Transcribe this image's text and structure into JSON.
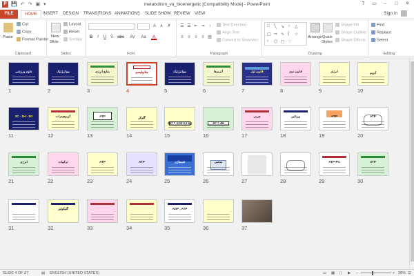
{
  "window": {
    "title": "metabolism_va_bioenergetic [Compatibility Mode] - PowerPoint"
  },
  "qat": {
    "save": "💾",
    "undo": "↶",
    "redo": "↷",
    "start": "▣",
    "more": "▾"
  },
  "window_controls": {
    "help": "?",
    "ribbon_opts": "▭",
    "minimize": "–",
    "maximize": "□",
    "close": "✕"
  },
  "tabs": {
    "file": "FILE",
    "home": "HOME",
    "insert": "INSERT",
    "design": "DESIGN",
    "transitions": "TRANSITIONS",
    "animations": "ANIMATIONS",
    "slideshow": "SLIDE SHOW",
    "review": "REVIEW",
    "view": "VIEW"
  },
  "signin": "Sign in",
  "ribbon": {
    "clipboard": {
      "paste": "Paste",
      "cut": "Cut",
      "copy": "Copy",
      "format_painter": "Format Painter",
      "label": "Clipboard"
    },
    "slides": {
      "new_slide": "New",
      "new_slide2": "Slide",
      "layout": "Layout",
      "reset": "Reset",
      "section": "Section",
      "label": "Slides"
    },
    "font": {
      "bold": "B",
      "italic": "I",
      "underline": "U",
      "strike": "S",
      "shadow": "abc",
      "spacing": "AV",
      "case": "Aa",
      "color": "A",
      "grow": "A",
      "shrink": "A",
      "clear": "✗",
      "label": "Font"
    },
    "paragraph": {
      "text_direction": "Text Direction",
      "align_text": "Align Text",
      "convert_smartart": "Convert to SmartArt",
      "label": "Paragraph"
    },
    "drawing": {
      "arrange": "Arrange",
      "quick_styles": "Quick",
      "quick_styles2": "Styles",
      "shape_fill": "Shape Fill",
      "shape_outline": "Shape Outline",
      "shape_effects": "Shape Effects",
      "label": "Drawing"
    },
    "editing": {
      "find": "Find",
      "replace": "Replace",
      "select": "Select",
      "label": "Editing"
    }
  },
  "slides": [
    {
      "n": "1",
      "bg": "#1a1f6e",
      "title": "علوم ورزشی",
      "tc": "#ffffff",
      "style": "dark"
    },
    {
      "n": "2",
      "bg": "#1a1f6e",
      "title": "بیوانرژتیک",
      "tc": "#ffffff",
      "style": "dark-lines"
    },
    {
      "n": "3",
      "bg": "#f4f6cc",
      "title": "منابع انرژی",
      "tc": "#222222",
      "style": "green-bars"
    },
    {
      "n": "4",
      "bg": "#ffffff",
      "title": "متابولیسم",
      "tc": "#c00000",
      "style": "selected"
    },
    {
      "n": "5",
      "bg": "#1a1f6e",
      "title": "بیوانرژتیک",
      "tc": "#ffffff",
      "style": "dark-lines"
    },
    {
      "n": "6",
      "bg": "#f4f6cc",
      "title": "آنزیم‌ها",
      "tc": "#222222",
      "style": "green-bars"
    },
    {
      "n": "7",
      "bg": "#2a2f8a",
      "title": "قانون اول",
      "tc": "#ffff66",
      "style": "dark-bar"
    },
    {
      "n": "8",
      "bg": "#ffd6ec",
      "title": "قانون دوم",
      "tc": "#222222",
      "style": "pink"
    },
    {
      "n": "9",
      "bg": "#ffffcc",
      "title": "انرژی",
      "tc": "#222222",
      "style": "light"
    },
    {
      "n": "10",
      "bg": "#ffffcc",
      "title": "آنزیم",
      "tc": "#222222",
      "style": "light-center"
    },
    {
      "n": "11",
      "bg": "#1a1f6e",
      "title": "2C - 1H - 1O",
      "tc": "#ffff66",
      "style": "dark"
    },
    {
      "n": "12",
      "bg": "#ffffcc",
      "title": "کربوهیدرات",
      "tc": "#222222",
      "style": "red-bar"
    },
    {
      "n": "13",
      "bg": "#d6f2d6",
      "title": "ATP",
      "tc": "#222222",
      "style": "box"
    },
    {
      "n": "14",
      "bg": "#ffffcc",
      "title": "گلوکز",
      "tc": "#222222",
      "style": "light-center"
    },
    {
      "n": "15",
      "bg": "#ffffcc",
      "title": "367 = 2.03 KJ kg",
      "tc": "#222222",
      "style": "formula"
    },
    {
      "n": "16",
      "bg": "#d6f2d6",
      "title": "3C = 4H",
      "tc": "#222222",
      "style": "formula"
    },
    {
      "n": "17",
      "bg": "#ffd6ec",
      "title": "چربی",
      "tc": "#222222",
      "style": "pink-bar"
    },
    {
      "n": "18",
      "bg": "#ffffff",
      "title": "پروتئین",
      "tc": "#222222",
      "style": "blue-bar"
    },
    {
      "n": "19",
      "bg": "#ffffff",
      "title": "ATP",
      "tc": "#222222",
      "style": "orange"
    },
    {
      "n": "20",
      "bg": "#ffffff",
      "title": "ATP",
      "tc": "#222222",
      "style": "diagram"
    },
    {
      "n": "21",
      "bg": "#d6f2d6",
      "title": "انرژی",
      "tc": "#222222",
      "style": "green-bar"
    },
    {
      "n": "22",
      "bg": "#ffd6ec",
      "title": "ترکیبات",
      "tc": "#222222",
      "style": "pink"
    },
    {
      "n": "23",
      "bg": "#ffffcc",
      "title": "ATP",
      "tc": "#222222",
      "style": "light"
    },
    {
      "n": "24",
      "bg": "#e8e0ff",
      "title": "ATP",
      "tc": "#222222",
      "style": "lavender"
    },
    {
      "n": "25",
      "bg": "#3a6fd4",
      "title": "فسفاژن",
      "tc": "#ffffff",
      "style": "blue-title"
    },
    {
      "n": "26",
      "bg": "#ffffff",
      "title": "منحنی",
      "tc": "#222222",
      "style": "chart"
    },
    {
      "n": "27",
      "bg": "#ffffff",
      "title": "",
      "tc": "#222222",
      "style": "grey"
    },
    {
      "n": "28",
      "bg": "#ffffff",
      "title": "",
      "tc": "#222222",
      "style": "diagram2"
    },
    {
      "n": "29",
      "bg": "#ffffff",
      "title": "ATP-PC",
      "tc": "#222222",
      "style": "red-bar"
    },
    {
      "n": "30",
      "bg": "#d6f2d6",
      "title": "ATP",
      "tc": "#222222",
      "style": "green-bar"
    },
    {
      "n": "31",
      "bg": "#ffffff",
      "title": "",
      "tc": "#222222",
      "style": "blue-bar"
    },
    {
      "n": "32",
      "bg": "#ffffcc",
      "title": "گلیکولیز",
      "tc": "#222222",
      "style": "dark-top"
    },
    {
      "n": "33",
      "bg": "#ffd6ec",
      "title": "",
      "tc": "#222222",
      "style": "pink-bar"
    },
    {
      "n": "34",
      "bg": "#ffffcc",
      "title": "",
      "tc": "#222222",
      "style": "red-bar"
    },
    {
      "n": "35",
      "bg": "#ffffff",
      "title": "ADP , ATP",
      "tc": "#222222",
      "style": "blue-bar"
    },
    {
      "n": "36",
      "bg": "#ffffcc",
      "title": "",
      "tc": "#222222",
      "style": "light"
    },
    {
      "n": "37",
      "bg": "#7a6a5a",
      "title": "",
      "tc": "#ffffff",
      "style": "photo"
    }
  ],
  "status": {
    "slide_info": "SLIDE 4 OF 37",
    "language": "ENGLISH (UNITED STATES)",
    "zoom": "38%",
    "zoom_fraction": 0.38
  }
}
